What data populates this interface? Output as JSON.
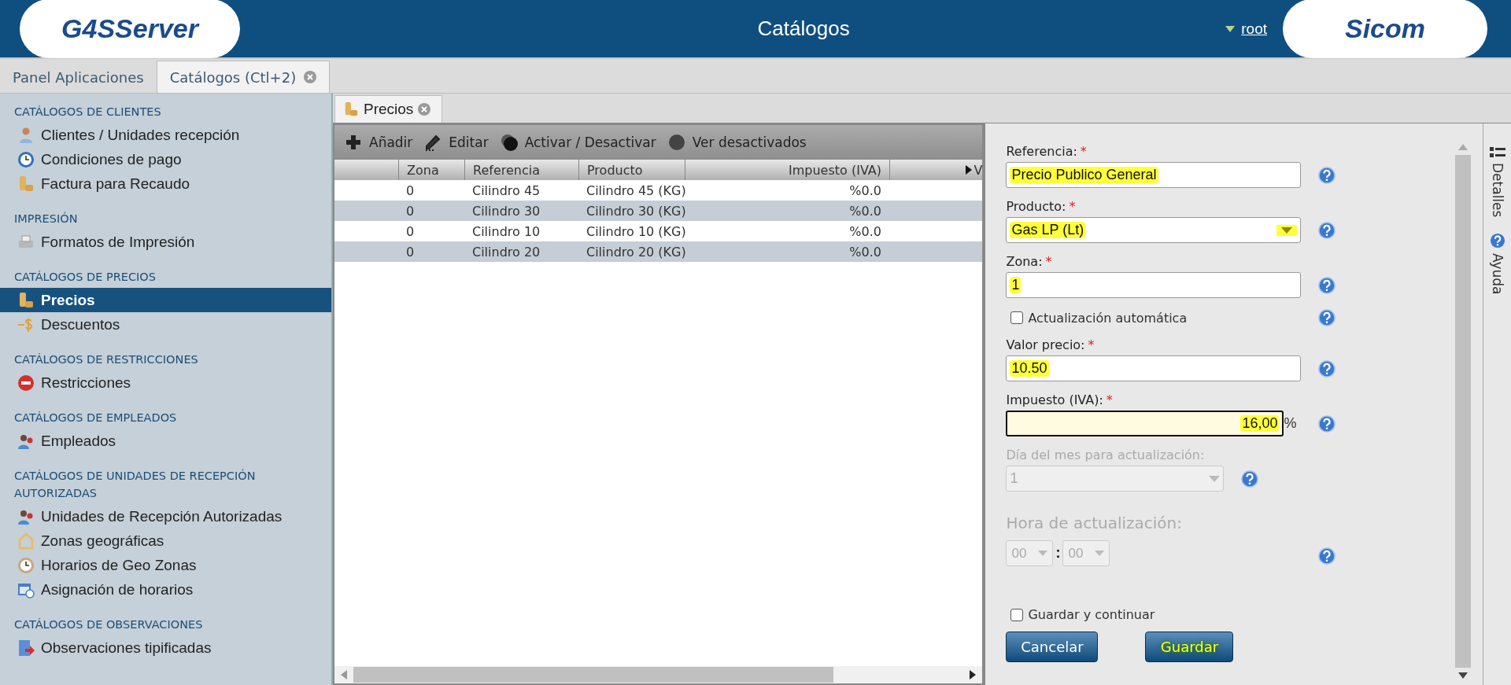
{
  "header": {
    "logo_left": "G4SServer",
    "title": "Catálogos",
    "user": "root",
    "logo_right": "Sicom"
  },
  "app_tabs": [
    {
      "label": "Panel Aplicaciones",
      "selected": false
    },
    {
      "label": "Catálogos (Ctl+2)",
      "selected": true
    }
  ],
  "sidebar": {
    "sections": [
      {
        "title": "CATÁLOGOS DE CLIENTES",
        "items": [
          {
            "label": "Clientes / Unidades recepción",
            "selected": false
          },
          {
            "label": "Condiciones de pago",
            "selected": false
          },
          {
            "label": "Factura para Recaudo",
            "selected": false
          }
        ]
      },
      {
        "title": "IMPRESIÓN",
        "items": [
          {
            "label": "Formatos de Impresión",
            "selected": false
          }
        ]
      },
      {
        "title": "CATÁLOGOS DE PRECIOS",
        "items": [
          {
            "label": "Precios",
            "selected": true
          },
          {
            "label": "Descuentos",
            "selected": false
          }
        ]
      },
      {
        "title": "CATÁLOGOS DE RESTRICCIONES",
        "items": [
          {
            "label": "Restricciones",
            "selected": false
          }
        ]
      },
      {
        "title": "CATÁLOGOS DE EMPLEADOS",
        "items": [
          {
            "label": "Empleados",
            "selected": false
          }
        ]
      },
      {
        "title": "CATÁLOGOS DE UNIDADES DE RECEPCIÓN AUTORIZADAS",
        "items": [
          {
            "label": "Unidades de Recepción Autorizadas",
            "selected": false
          },
          {
            "label": "Zonas geográficas",
            "selected": false
          },
          {
            "label": "Horarios de Geo Zonas",
            "selected": false
          },
          {
            "label": "Asignación de horarios",
            "selected": false
          }
        ]
      },
      {
        "title": "CATÁLOGOS DE OBSERVACIONES",
        "items": [
          {
            "label": "Observaciones tipificadas",
            "selected": false
          }
        ]
      }
    ]
  },
  "content_tabs": [
    {
      "label": "Precios",
      "selected": true
    }
  ],
  "toolbar": [
    "Añadir",
    "Editar",
    "Activar / Desactivar",
    "Ver desactivados"
  ],
  "table": {
    "columns": [
      "Zona",
      "Referencia",
      "Producto",
      "Impuesto (IVA)",
      "V"
    ],
    "rows": [
      {
        "cells": [
          "0",
          "Cilindro 45",
          "Cilindro 45 (KG)",
          "%0.0"
        ]
      },
      {
        "cells": [
          "0",
          "Cilindro 30",
          "Cilindro 30 (KG)",
          "%0.0"
        ]
      },
      {
        "cells": [
          "0",
          "Cilindro 10",
          "Cilindro 10 (KG)",
          "%0.0"
        ]
      },
      {
        "cells": [
          "0",
          "Cilindro 20",
          "Cilindro 20 (KG)",
          "%0.0"
        ]
      }
    ]
  },
  "form": {
    "fields": [
      {
        "kind": "text",
        "label": "Referencia:",
        "required_mark": "*",
        "value": "Precio Publico General",
        "highlighted": true
      },
      {
        "kind": "select",
        "label": "Producto:",
        "required_mark": "*",
        "value": "Gas LP (Lt)",
        "highlighted": true,
        "disabled": false
      },
      {
        "kind": "text",
        "label": "Zona:",
        "required_mark": "*",
        "value": "1",
        "highlighted": true
      },
      {
        "kind": "checkbox",
        "label": "Actualización automática",
        "checked": false
      },
      {
        "kind": "text",
        "label": "Valor precio:",
        "required_mark": "*",
        "value": "10.50",
        "highlighted": true
      },
      {
        "kind": "percent",
        "label": "Impuesto (IVA):",
        "required_mark": "*",
        "value": "16,00",
        "unit": "%",
        "highlighted": true
      },
      {
        "kind": "select",
        "label": "Día del mes para actualización:",
        "value": "1",
        "highlighted": false,
        "disabled": true
      },
      {
        "kind": "time",
        "label": "Hora de actualización:",
        "hours": "00",
        "separator": ":",
        "minutes": "00",
        "disabled": true
      }
    ],
    "save_continue": {
      "label": "Guardar y continuar",
      "checked": false
    },
    "buttons": [
      {
        "label": "Cancelar",
        "highlighted": false
      },
      {
        "label": "Guardar",
        "highlighted": true
      }
    ]
  },
  "side_tabs": [
    "Detalles",
    "Ayuda"
  ]
}
